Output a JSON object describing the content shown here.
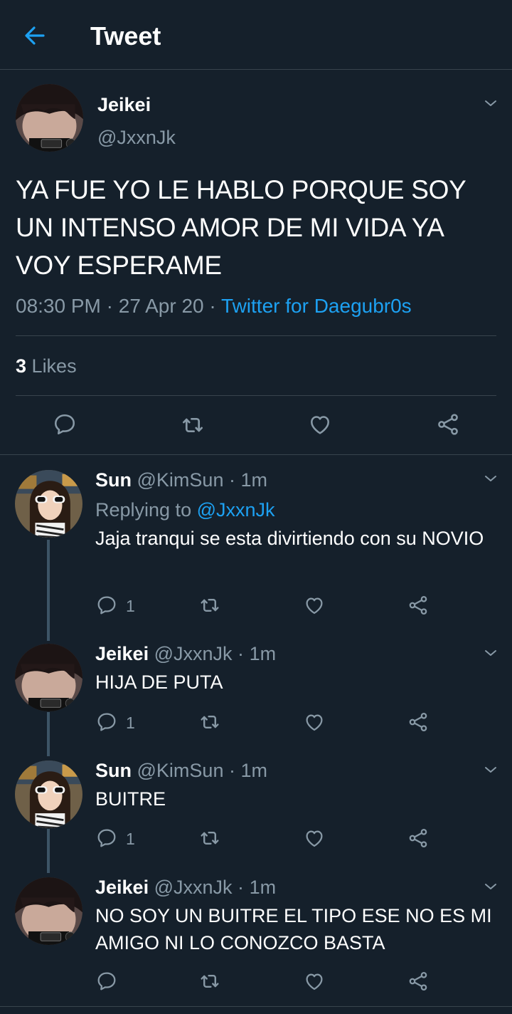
{
  "header": {
    "title": "Tweet"
  },
  "main_tweet": {
    "name": "Jeikei",
    "handle": "@JxxnJk",
    "text": "YA FUE YO LE HABLO PORQUE SOY UN INTENSO AMOR DE MI VIDA YA VOY ESPERAME",
    "time": "08:30 PM",
    "date": "27 Apr 20",
    "separator": "·",
    "source": "Twitter for Daegubr0s",
    "likes_count": "3",
    "likes_label": "Likes"
  },
  "replies": [
    {
      "name": "Sun",
      "handle": "@KimSun",
      "sep": "·",
      "time": "1m",
      "replying_label": "Replying to",
      "replying_to": "@JxxnJk",
      "text": "Jaja tranqui se esta divirtiendo con su NOVIO",
      "reply_count": "1"
    },
    {
      "name": "Jeikei",
      "handle": "@JxxnJk",
      "sep": "·",
      "time": "1m",
      "text": "HIJA DE PUTA",
      "reply_count": "1"
    },
    {
      "name": "Sun",
      "handle": "@KimSun",
      "sep": "·",
      "time": "1m",
      "text": "BUITRE",
      "reply_count": "1"
    },
    {
      "name": "Jeikei",
      "handle": "@JxxnJk",
      "sep": "·",
      "time": "1m",
      "text": "NO SOY UN BUITRE EL TIPO ESE NO ES MI AMIGO NI LO CONOZCO BASTA",
      "reply_count": ""
    }
  ],
  "colors": {
    "background": "#15202b",
    "accent": "#1da1f2",
    "muted": "#8899a6",
    "divider": "#38444d"
  }
}
